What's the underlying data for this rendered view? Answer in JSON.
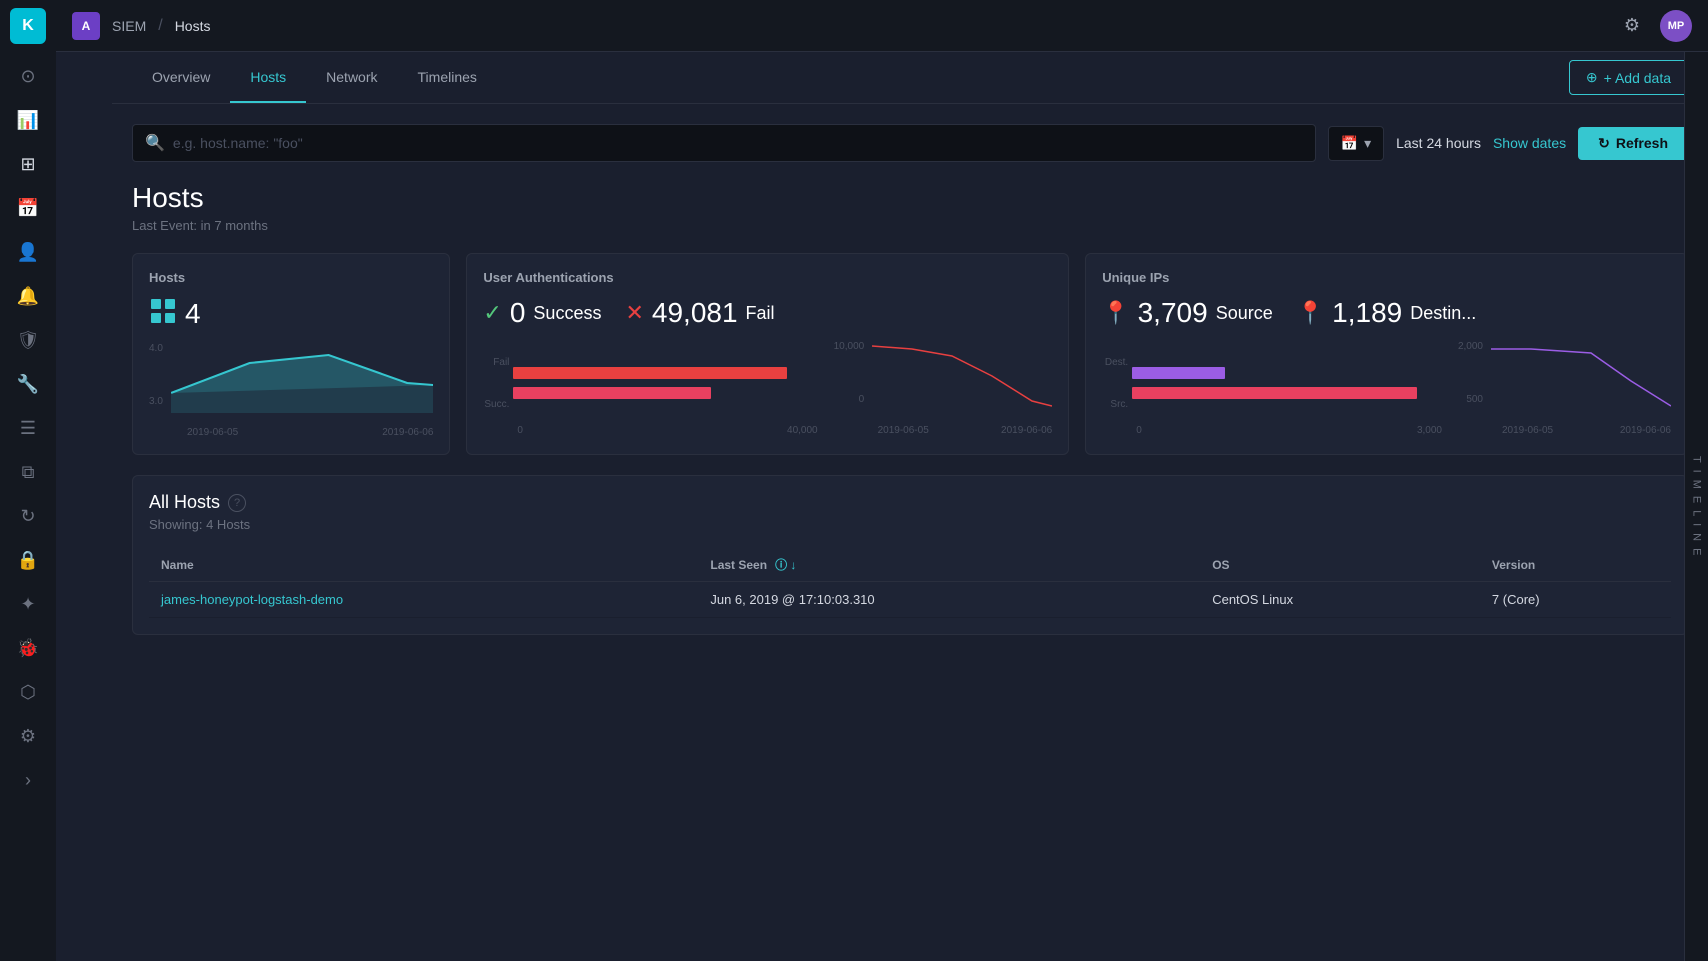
{
  "app": {
    "logo_initial": "K",
    "app_initial": "A",
    "app_bg": "#6c3fc5",
    "siem_label": "SIEM",
    "page_label": "Hosts",
    "avatar_label": "MP",
    "avatar_bg": "#7c4fc5"
  },
  "tabs": [
    {
      "label": "Overview",
      "active": false
    },
    {
      "label": "Hosts",
      "active": true
    },
    {
      "label": "Network",
      "active": false
    },
    {
      "label": "Timelines",
      "active": false
    }
  ],
  "add_data_label": "+ Add data",
  "search": {
    "placeholder": "e.g. host.name: \"foo\""
  },
  "time": {
    "range": "Last 24 hours",
    "show_dates_label": "Show dates",
    "refresh_label": "Refresh"
  },
  "hosts_header": {
    "title": "Hosts",
    "subtitle": "Last Event: in 7 months"
  },
  "stats": {
    "hosts": {
      "title": "Hosts",
      "count": "4",
      "chart_y_max": "4.0",
      "chart_y_min": "3.0",
      "chart_dates": [
        "2019-06-05",
        "2019-06-06"
      ]
    },
    "user_auth": {
      "title": "User Authentications",
      "success_count": "0",
      "success_label": "Success",
      "fail_count": "49,081",
      "fail_label": "Fail",
      "bar_labels": [
        "Fail",
        "Succ."
      ],
      "bar_x": [
        "0",
        "40,000"
      ],
      "line_y_max": "10,000",
      "line_y_min": "0",
      "chart_dates": [
        "2019-06-05",
        "2019-06-06"
      ]
    },
    "unique_ips": {
      "title": "Unique IPs",
      "source_count": "3,709",
      "source_label": "Source",
      "dest_count": "1,189",
      "dest_label": "Destin...",
      "bar_labels": [
        "Dest.",
        "Src."
      ],
      "bar_x": [
        "0",
        "3,000"
      ],
      "line_y_max": "2,000",
      "line_y_min": "500",
      "chart_dates": [
        "2019-06-05",
        "2019-06-06"
      ]
    }
  },
  "all_hosts": {
    "title": "All Hosts",
    "showing": "Showing: 4 Hosts",
    "columns": [
      "Name",
      "Last Seen",
      "OS",
      "Version"
    ],
    "rows": [
      {
        "name": "james-honeypot-logstash-demo",
        "last_seen": "Jun 6, 2019 @ 17:10:03.310",
        "os": "CentOS Linux",
        "version": "7 (Core)"
      }
    ]
  },
  "sidebar_icons": [
    "clock",
    "chart-bar",
    "grid",
    "calendar",
    "user",
    "bell",
    "shield",
    "wrench",
    "list",
    "layers",
    "refresh",
    "lock",
    "network",
    "bug",
    "brain",
    "settings",
    "chevron-right"
  ],
  "timeline_label": "T I M E L I N E"
}
